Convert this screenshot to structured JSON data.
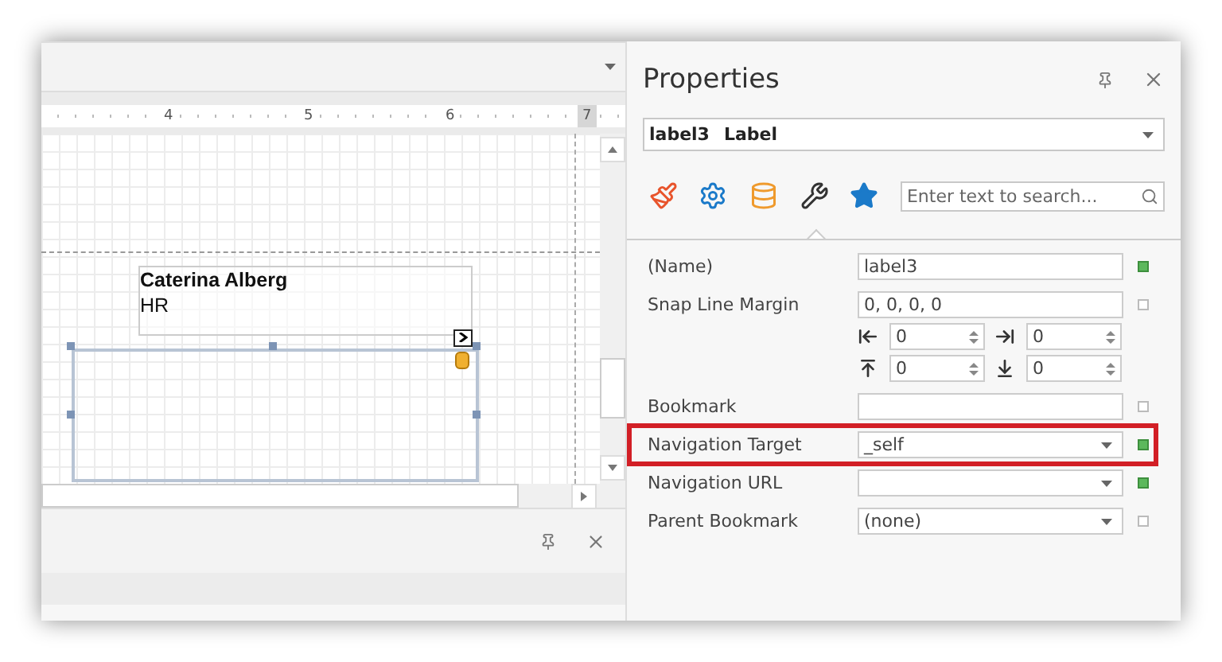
{
  "designer": {
    "ruler": [
      "4",
      "5",
      "6",
      "7"
    ],
    "label_control": {
      "title": "Caterina Alberg",
      "subtitle": "HR"
    },
    "empty_control": {
      "selected": true
    }
  },
  "properties": {
    "title": "Properties",
    "object": {
      "name": "label3",
      "type": "Label"
    },
    "tabs": [
      {
        "selected": false
      },
      {
        "selected": false
      },
      {
        "selected": false
      },
      {
        "selected": true
      },
      {
        "selected": false
      }
    ],
    "search": {
      "placeholder": "Enter text to search..."
    },
    "rows": [
      {
        "label": "(Name)",
        "kind": "text",
        "value": "label3",
        "modified": true,
        "highlighted": false
      },
      {
        "label": "Snap Line Margin",
        "kind": "padding",
        "value": "0, 0, 0, 0",
        "modified": false,
        "highlighted": false,
        "padding": [
          {
            "kind": "left",
            "value": "0"
          },
          {
            "kind": "right",
            "value": "0"
          },
          {
            "kind": "top",
            "value": "0"
          },
          {
            "kind": "bottom",
            "value": "0"
          }
        ]
      },
      {
        "label": "Bookmark",
        "kind": "text",
        "modified": false,
        "highlighted": false
      },
      {
        "label": "Navigation Target",
        "kind": "combo",
        "value": "_self",
        "modified": true,
        "highlighted": true
      },
      {
        "label": "Navigation URL",
        "kind": "combo",
        "modified": true,
        "highlighted": false
      },
      {
        "label": "Parent Bookmark",
        "kind": "combo",
        "value": "(none)",
        "modified": false,
        "highlighted": false
      }
    ]
  }
}
